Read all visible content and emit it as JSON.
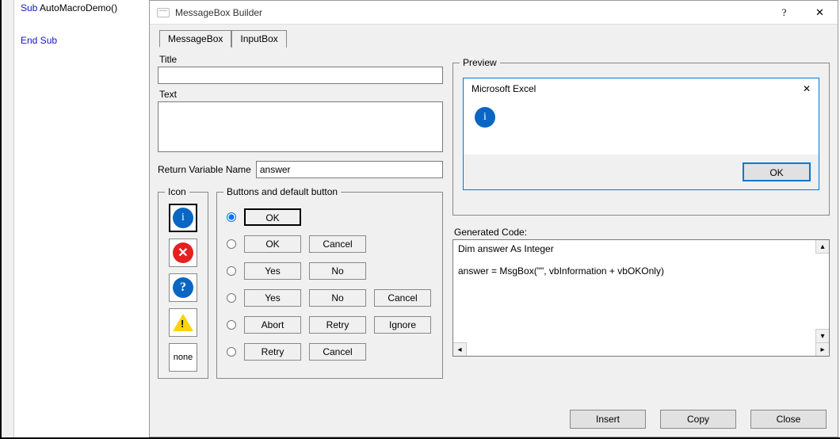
{
  "codepane": {
    "line1_kw": "Sub",
    "line1_rest": " AutoMacroDemo()",
    "line2_kw": "End Sub"
  },
  "dialog": {
    "title": "MessageBox Builder",
    "tabs": {
      "msgbox": "MessageBox",
      "inputbox": "InputBox"
    },
    "labels": {
      "title": "Title",
      "text": "Text",
      "return_var": "Return Variable Name",
      "icon": "Icon",
      "buttons": "Buttons and default button",
      "preview": "Preview",
      "gencode": "Generated Code:"
    },
    "values": {
      "title_input": "",
      "text_input": "",
      "return_var": "answer"
    },
    "icons": {
      "info": "i",
      "error": "✕",
      "question": "?",
      "none": "none"
    },
    "button_rows": {
      "r1": {
        "b1": "OK"
      },
      "r2": {
        "b1": "OK",
        "b2": "Cancel"
      },
      "r3": {
        "b1": "Yes",
        "b2": "No"
      },
      "r4": {
        "b1": "Yes",
        "b2": "No",
        "b3": "Cancel"
      },
      "r5": {
        "b1": "Abort",
        "b2": "Retry",
        "b3": "Ignore"
      },
      "r6": {
        "b1": "Retry",
        "b2": "Cancel"
      }
    },
    "preview": {
      "app": "Microsoft Excel",
      "ok": "OK"
    },
    "gencode": "Dim answer As Integer\n\nanswer = MsgBox(\"\", vbInformation + vbOKOnly)",
    "footer": {
      "insert": "Insert",
      "copy": "Copy",
      "close": "Close"
    }
  }
}
